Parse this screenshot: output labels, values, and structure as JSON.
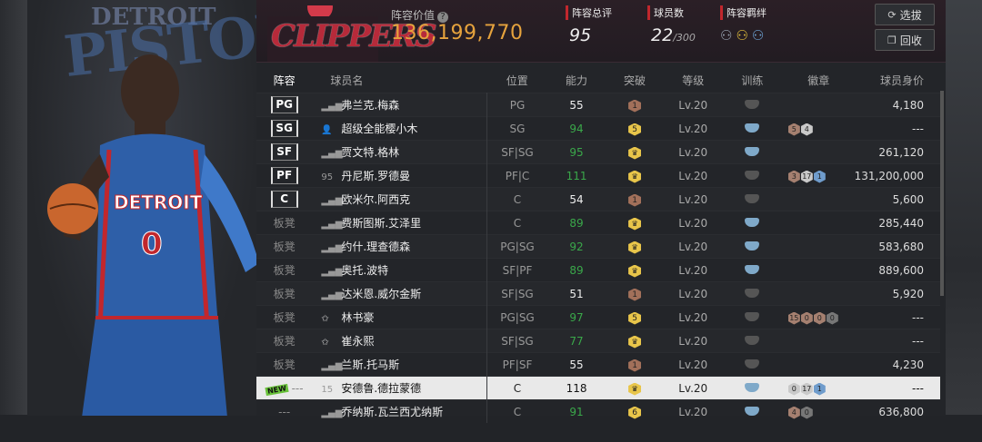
{
  "header": {
    "value_label": "阵容价值",
    "value_help": "?",
    "value": "136,199,770",
    "stats": [
      {
        "label": "阵容总评",
        "value": "95"
      },
      {
        "label": "球员数",
        "value": "22",
        "suffix": "/300"
      },
      {
        "label": "阵容羁绊",
        "value": ""
      }
    ],
    "buttons": [
      {
        "label": "选拔",
        "icon": "refresh-icon"
      },
      {
        "label": "回收",
        "icon": "recycle-icon"
      }
    ]
  },
  "team_watermark": "CLIPPERS",
  "left_logo": "PISTONS",
  "left_logo_top": "DETROIT",
  "jersey_text": "DETROIT",
  "jersey_number": "0",
  "columns": [
    "阵容",
    "球员名",
    "位置",
    "能力",
    "突破",
    "等级",
    "训练",
    "徽章",
    "球员身价"
  ],
  "rows": [
    {
      "slot": "PG",
      "starter": true,
      "icon": "signal",
      "name": "弗兰克.梅森",
      "pos": "PG",
      "ability": "55",
      "ab": "white",
      "brk": "1",
      "lv": "Lv.20",
      "train": "gray",
      "badges": [],
      "price": "4,180"
    },
    {
      "slot": "SG",
      "starter": true,
      "icon": "avatar",
      "name": "超级全能樱小木",
      "pos": "SG",
      "ability": "94",
      "ab": "green",
      "brk": "5",
      "lv": "Lv.20",
      "train": "blue",
      "badges": [
        [
          "5",
          "br"
        ],
        [
          "4",
          "sv"
        ]
      ],
      "price": "---"
    },
    {
      "slot": "SF",
      "starter": true,
      "icon": "signal",
      "name": "贾文特.格林",
      "pos": "SF|SG",
      "ability": "95",
      "ab": "green",
      "brk": "crown",
      "lv": "Lv.20",
      "train": "blue",
      "badges": [],
      "price": "261,120"
    },
    {
      "slot": "PF",
      "starter": true,
      "icon": "95",
      "name": "丹尼斯.罗德曼",
      "pos": "PF|C",
      "ability": "111",
      "ab": "green",
      "brk": "crown",
      "lv": "Lv.20",
      "train": "gray",
      "badges": [
        [
          "3",
          "br"
        ],
        [
          "17",
          "sv"
        ],
        [
          "1",
          "bl"
        ]
      ],
      "price": "131,200,000"
    },
    {
      "slot": "C",
      "starter": true,
      "icon": "signal",
      "name": "欧米尔.阿西克",
      "pos": "C",
      "ability": "54",
      "ab": "white",
      "brk": "1",
      "lv": "Lv.20",
      "train": "gray",
      "badges": [],
      "price": "5,600"
    },
    {
      "slot": "板凳",
      "starter": false,
      "icon": "signal",
      "name": "费斯图斯.艾泽里",
      "pos": "C",
      "ability": "89",
      "ab": "green",
      "brk": "crown",
      "lv": "Lv.20",
      "train": "blue",
      "badges": [],
      "price": "285,440"
    },
    {
      "slot": "板凳",
      "starter": false,
      "icon": "signal",
      "name": "约什.理查德森",
      "pos": "PG|SG",
      "ability": "92",
      "ab": "green",
      "brk": "crown",
      "lv": "Lv.20",
      "train": "blue",
      "badges": [],
      "price": "583,680"
    },
    {
      "slot": "板凳",
      "starter": false,
      "icon": "signal",
      "name": "奥托.波特",
      "pos": "SF|PF",
      "ability": "89",
      "ab": "green",
      "brk": "crown",
      "lv": "Lv.20",
      "train": "blue",
      "badges": [],
      "price": "889,600"
    },
    {
      "slot": "板凳",
      "starter": false,
      "icon": "signal",
      "name": "达米恩.威尔金斯",
      "pos": "SF|SG",
      "ability": "51",
      "ab": "white",
      "brk": "1",
      "lv": "Lv.20",
      "train": "gray",
      "badges": [],
      "price": "5,920"
    },
    {
      "slot": "板凳",
      "starter": false,
      "icon": "star",
      "name": "林书豪",
      "pos": "PG|SG",
      "ability": "97",
      "ab": "green",
      "brk": "5",
      "lv": "Lv.20",
      "train": "gray",
      "badges": [
        [
          "15",
          "br"
        ],
        [
          "0",
          "br"
        ],
        [
          "0",
          "br"
        ],
        [
          "0",
          "gy"
        ]
      ],
      "price": "---"
    },
    {
      "slot": "板凳",
      "starter": false,
      "icon": "star",
      "name": "崔永熙",
      "pos": "SF|SG",
      "ability": "77",
      "ab": "green",
      "brk": "crown",
      "lv": "Lv.20",
      "train": "gray",
      "badges": [],
      "price": "---"
    },
    {
      "slot": "板凳",
      "starter": false,
      "icon": "signal",
      "name": "兰斯.托马斯",
      "pos": "PF|SF",
      "ability": "55",
      "ab": "white",
      "brk": "1",
      "lv": "Lv.20",
      "train": "gray",
      "badges": [],
      "price": "4,230"
    },
    {
      "slot": "---",
      "starter": false,
      "selected": true,
      "new": true,
      "new_label": "NEW",
      "icon": "15",
      "name": "安德鲁.德拉蒙德",
      "pos": "C",
      "ability": "118",
      "ab": "white",
      "brk": "crown",
      "lv": "Lv.20",
      "train": "blue",
      "badges": [
        [
          "0",
          "sv"
        ],
        [
          "17",
          "sv"
        ],
        [
          "1",
          "bl"
        ]
      ],
      "price": "---"
    },
    {
      "slot": "---",
      "starter": false,
      "icon": "signal",
      "name": "乔纳斯.瓦兰西尤纳斯",
      "pos": "C",
      "ability": "91",
      "ab": "green",
      "brk": "6",
      "lv": "Lv.20",
      "train": "blue",
      "badges": [
        [
          "4",
          "br"
        ],
        [
          "0",
          "gy"
        ]
      ],
      "price": "636,800"
    }
  ]
}
